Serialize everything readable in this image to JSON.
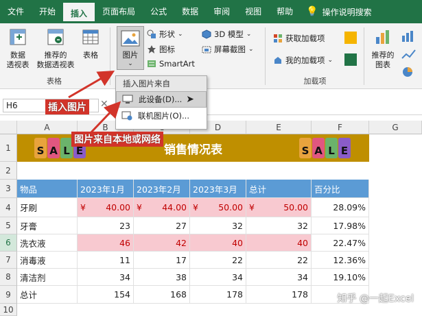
{
  "tabs": [
    "文件",
    "开始",
    "插入",
    "页面布局",
    "公式",
    "数据",
    "审阅",
    "视图",
    "帮助"
  ],
  "active_tab": "插入",
  "tell_me": "操作说明搜索",
  "ribbon": {
    "tables_group": {
      "label": "表格",
      "pivot": "数据\n透视表",
      "recommended_pivot": "推荐的\n数据透视表",
      "table": "表格"
    },
    "illustrations": {
      "picture": "图片",
      "shapes": "形状",
      "icons": "图标",
      "smartart": "SmartArt",
      "model3d": "3D 模型",
      "screenshot": "屏幕截图"
    },
    "addins_group": {
      "label": "加载项",
      "get_addins": "获取加载项",
      "my_addins": "我的加载项"
    },
    "charts": {
      "recommended": "推荐的\n图表"
    }
  },
  "picture_menu": {
    "header": "插入图片来自",
    "this_device": "此设备(D)...",
    "online": "联机图片(O)..."
  },
  "name_box": "H6",
  "columns": [
    "A",
    "B",
    "C",
    "D",
    "E",
    "F",
    "G"
  ],
  "rows": [
    "1",
    "2",
    "3",
    "4",
    "5",
    "6",
    "7",
    "8",
    "9",
    "10"
  ],
  "sheet_title": "销售情况表",
  "sale_letters": [
    "S",
    "A",
    "L",
    "E"
  ],
  "table": {
    "headers": [
      "物品",
      "2023年1月",
      "2023年2月",
      "2023年3月",
      "总计",
      "百分比"
    ],
    "currency_symbol": "¥",
    "body": [
      [
        "牙刷",
        "40.00",
        "44.00",
        "50.00",
        "50.00",
        "28.09%"
      ],
      [
        "牙膏",
        "23",
        "27",
        "32",
        "32",
        "17.98%"
      ],
      [
        "洗衣液",
        "46",
        "42",
        "40",
        "40",
        "22.47%"
      ],
      [
        "消毒液",
        "11",
        "17",
        "22",
        "22",
        "12.36%"
      ],
      [
        "清洁剂",
        "34",
        "38",
        "34",
        "34",
        "19.10%"
      ],
      [
        "总计",
        "154",
        "168",
        "178",
        "178",
        ""
      ]
    ]
  },
  "annotations": {
    "insert_picture": "插入图片",
    "local_source": "图片来自本地或网络"
  },
  "watermark": "知乎 @一起Excel",
  "colors": {
    "ribbon_green": "#217346",
    "title_bg": "#bf8f00",
    "header_bg": "#5b9bd5",
    "highlight_bg": "#f8c9d0",
    "annotation_red": "#d2342a"
  }
}
